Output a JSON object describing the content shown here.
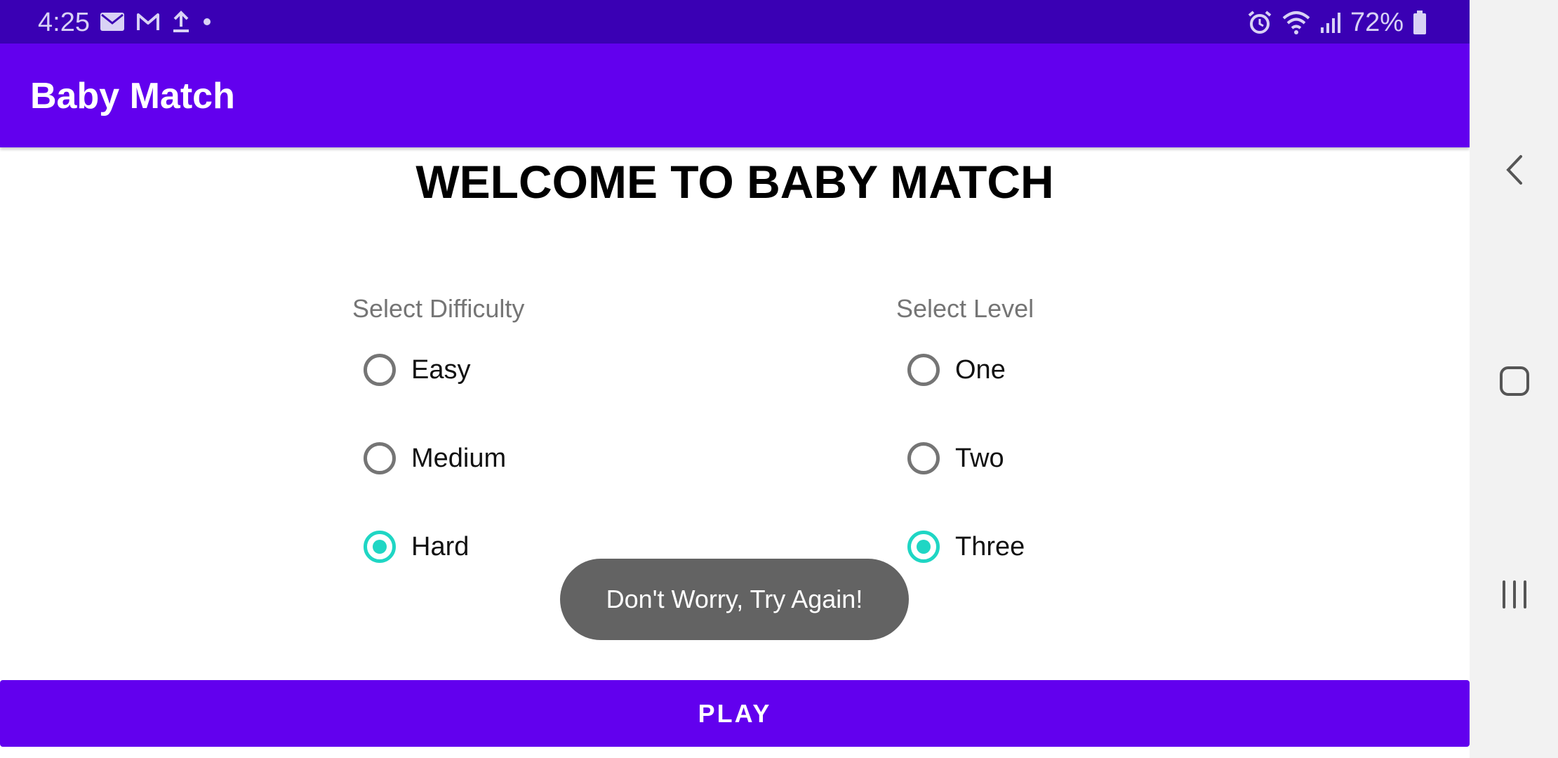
{
  "status_bar": {
    "time": "4:25",
    "battery": "72%",
    "left_icons": [
      "mail-icon",
      "gmail-icon",
      "upload-icon",
      "dot-icon"
    ],
    "right_icons": [
      "alarm-icon",
      "wifi-icon",
      "signal-icon",
      "battery-icon"
    ]
  },
  "app_bar": {
    "title": "Baby Match"
  },
  "main": {
    "welcome_title": "WELCOME TO BABY MATCH",
    "difficulty": {
      "label": "Select Difficulty",
      "options": [
        {
          "label": "Easy",
          "checked": false
        },
        {
          "label": "Medium",
          "checked": false
        },
        {
          "label": "Hard",
          "checked": true
        }
      ]
    },
    "level": {
      "label": "Select Level",
      "options": [
        {
          "label": "One",
          "checked": false
        },
        {
          "label": "Two",
          "checked": false
        },
        {
          "label": "Three",
          "checked": true
        }
      ]
    }
  },
  "toast": {
    "message": "Don't Worry, Try Again!"
  },
  "play_button": {
    "label": "PLAY"
  },
  "nav_bar": {
    "buttons": [
      "back-icon",
      "home-icon",
      "recents-icon"
    ]
  },
  "colors": {
    "status_bar": "#3a00b4",
    "primary": "#6200ee",
    "accent": "#1fd6c4",
    "toast_bg": "#636363",
    "nav_bar": "#f2f2f2"
  }
}
